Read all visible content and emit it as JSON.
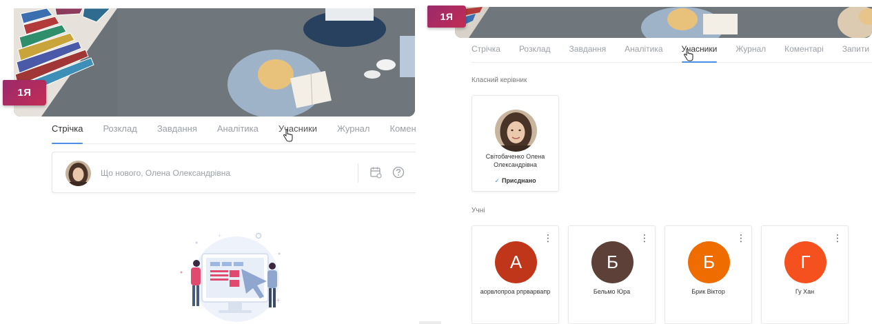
{
  "left": {
    "class_badge": "1Я",
    "tabs": [
      {
        "label": "Стрічка",
        "active": true
      },
      {
        "label": "Розклад",
        "active": false
      },
      {
        "label": "Завдання",
        "active": false
      },
      {
        "label": "Аналітика",
        "active": false
      },
      {
        "label": "Учасники",
        "active": false
      },
      {
        "label": "Журнал",
        "active": false
      },
      {
        "label": "Коментарі",
        "active": false
      }
    ],
    "composer": {
      "placeholder": "Що нового, Олена Олександрівна",
      "icons": [
        "calendar-icon",
        "help-icon"
      ]
    }
  },
  "right": {
    "class_badge": "1Я",
    "tabs": [
      {
        "label": "Стрічка",
        "active": false
      },
      {
        "label": "Розклад",
        "active": false
      },
      {
        "label": "Завдання",
        "active": false
      },
      {
        "label": "Аналітика",
        "active": false
      },
      {
        "label": "Учасники",
        "active": true
      },
      {
        "label": "Журнал",
        "active": false
      },
      {
        "label": "Коментарі",
        "active": false
      },
      {
        "label": "Запити",
        "active": false
      }
    ],
    "teacher_section_label": "Класний керівник",
    "teacher": {
      "name": "Світобаченко Олена Олександрівна",
      "status": "Присднано"
    },
    "students_section_label": "Учні",
    "students": [
      {
        "initial": "А",
        "name": "аорвлопроа рпрварвапр",
        "color": "#c0361a"
      },
      {
        "initial": "Б",
        "name": "Бельмо Юра",
        "color": "#5d4037"
      },
      {
        "initial": "Б",
        "name": "Брик Віктор",
        "color": "#ef6c00"
      },
      {
        "initial": "Г",
        "name": "Гу Хан",
        "color": "#f4511e"
      }
    ]
  }
}
